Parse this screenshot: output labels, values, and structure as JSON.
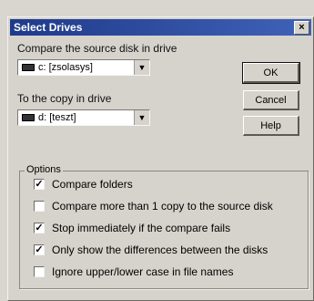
{
  "window": {
    "title": "Select Drives",
    "close_glyph": "×"
  },
  "source": {
    "label": "Compare the source disk in drive",
    "selected": "c: [zsolasys]",
    "drive_icon": "drive-icon"
  },
  "target": {
    "label": "To the copy in drive",
    "selected": "d: [teszt]",
    "drive_icon": "drive-icon"
  },
  "buttons": {
    "ok": "OK",
    "cancel": "Cancel",
    "help": "Help"
  },
  "options": {
    "group_title": "Options",
    "items": [
      {
        "label": "Compare folders",
        "checked": true
      },
      {
        "label": "Compare more than 1 copy to the source disk",
        "checked": false
      },
      {
        "label": "Stop immediately if the compare fails",
        "checked": true
      },
      {
        "label": "Only show the differences between the disks",
        "checked": true
      },
      {
        "label": "Ignore upper/lower case in file names",
        "checked": false
      }
    ]
  },
  "glyphs": {
    "check": "✓",
    "dropdown": "▼"
  }
}
